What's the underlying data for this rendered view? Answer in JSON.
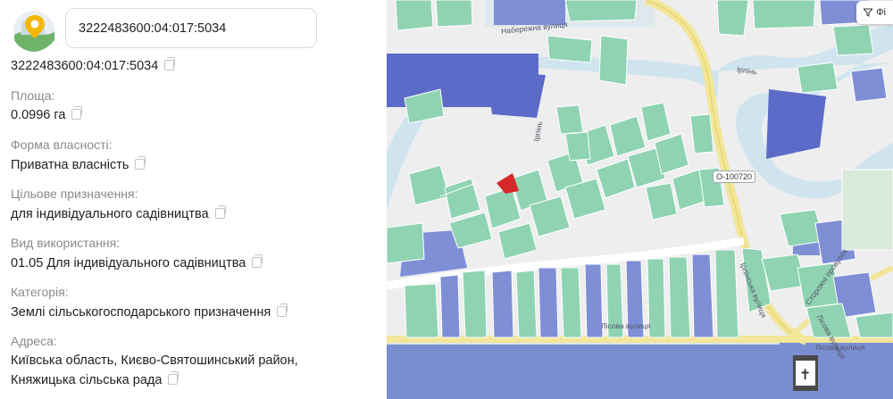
{
  "search": {
    "value": "3222483600:04:017:5034"
  },
  "parcel": {
    "cadastral_number": "3222483600:04:017:5034",
    "fields": [
      {
        "label": "Площа:",
        "value": "0.0996 га"
      },
      {
        "label": "Форма власності:",
        "value": "Приватна власність"
      },
      {
        "label": "Цільове призначення:",
        "value": "для індивідуального садівництва"
      },
      {
        "label": "Вид використання:",
        "value": "01.05 Для індивідуального садівництва"
      },
      {
        "label": "Категорія:",
        "value": "Землі сільськогосподарського призначення"
      },
      {
        "label": "Адреса:",
        "value": "Київська область, Києво-Святошинський район,",
        "value2": "Княжицька сільська рада"
      }
    ]
  },
  "map": {
    "filter_label": "Фі",
    "road_badge": "О-100720",
    "street_labels": {
      "north": "Набережна вулиця",
      "river_top": "Ірпінь",
      "river_mid": "Ірпінь",
      "east_street": "Ірпінська вулиця",
      "south_street": "Лісова вулиця",
      "south_east": "Лісова вулиця",
      "right_street_1": "Сторожні провулок",
      "right_street_2": "Лісова вулиця"
    },
    "colors": {
      "parcel_green": "#8fd3b3",
      "parcel_blue": "#7f8fd6",
      "parcel_dark_blue": "#5c6cc9",
      "highlight_red": "#d62828",
      "water": "#cfe4ee",
      "road": "#f2e69a"
    }
  }
}
